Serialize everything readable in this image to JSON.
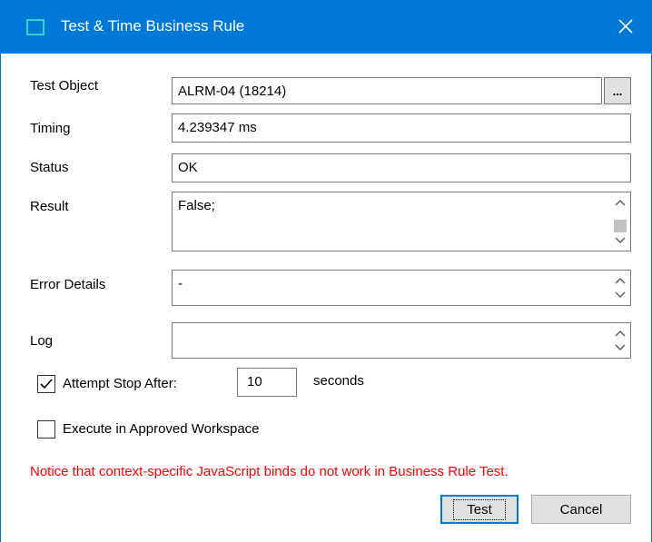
{
  "window": {
    "title": "Test & Time Business Rule",
    "accent": "#0078d7"
  },
  "fields": {
    "test_object": {
      "label": "Test Object",
      "value": "ALRM-04 (18214)",
      "browse_label": "..."
    },
    "timing": {
      "label": "Timing",
      "value": "4.239347 ms"
    },
    "status": {
      "label": "Status",
      "value": "OK"
    },
    "result": {
      "label": "Result",
      "value": "False;"
    },
    "error_details": {
      "label": "Error Details",
      "value": "-"
    },
    "log": {
      "label": "Log",
      "value": ""
    }
  },
  "attempt_stop": {
    "label": "Attempt Stop After:",
    "checked": true,
    "value": "10",
    "unit": "seconds"
  },
  "approved_ws": {
    "label": "Execute in Approved Workspace",
    "checked": false
  },
  "notice": {
    "text": "Notice that context-specific JavaScript binds do not work in Business Rule Test.",
    "color": "#ff0000"
  },
  "buttons": {
    "test": "Test",
    "cancel": "Cancel"
  }
}
